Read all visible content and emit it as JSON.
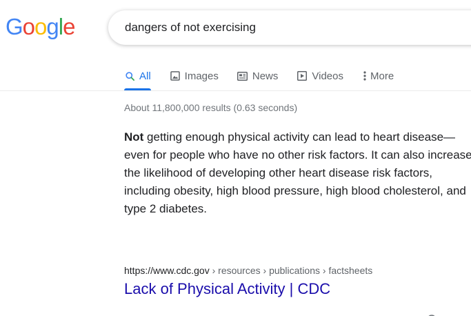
{
  "logo": {
    "letters": [
      "G",
      "o",
      "o",
      "g",
      "l",
      "e"
    ],
    "colors": [
      "#4285F4",
      "#EA4335",
      "#FBBC05",
      "#4285F4",
      "#34A853",
      "#EA4335"
    ]
  },
  "search": {
    "query": "dangers of not exercising"
  },
  "tabs": [
    {
      "label": "All",
      "icon": "search-icon",
      "active": true
    },
    {
      "label": "Images",
      "icon": "image-icon",
      "active": false
    },
    {
      "label": "News",
      "icon": "news-icon",
      "active": false
    },
    {
      "label": "Videos",
      "icon": "video-icon",
      "active": false
    },
    {
      "label": "More",
      "icon": "more-vertical-icon",
      "active": false
    }
  ],
  "stats": "About 11,800,000 results (0.63 seconds)",
  "snippet": {
    "bold_lead": "Not",
    "text": " getting enough physical activity can lead to heart disease—even for people who have no other risk factors. It can also increase the likelihood of developing other heart disease risk factors, including obesity, high blood pressure, high blood cholesterol, and type 2 diabetes."
  },
  "result": {
    "url_host": "https://www.cdc.gov",
    "url_path": " › resources › publications › factsheets",
    "title": "Lack of Physical Activity | CDC"
  },
  "colors": {
    "accent": "#1a73e8",
    "link": "#1a0dab",
    "muted": "#70757a"
  }
}
